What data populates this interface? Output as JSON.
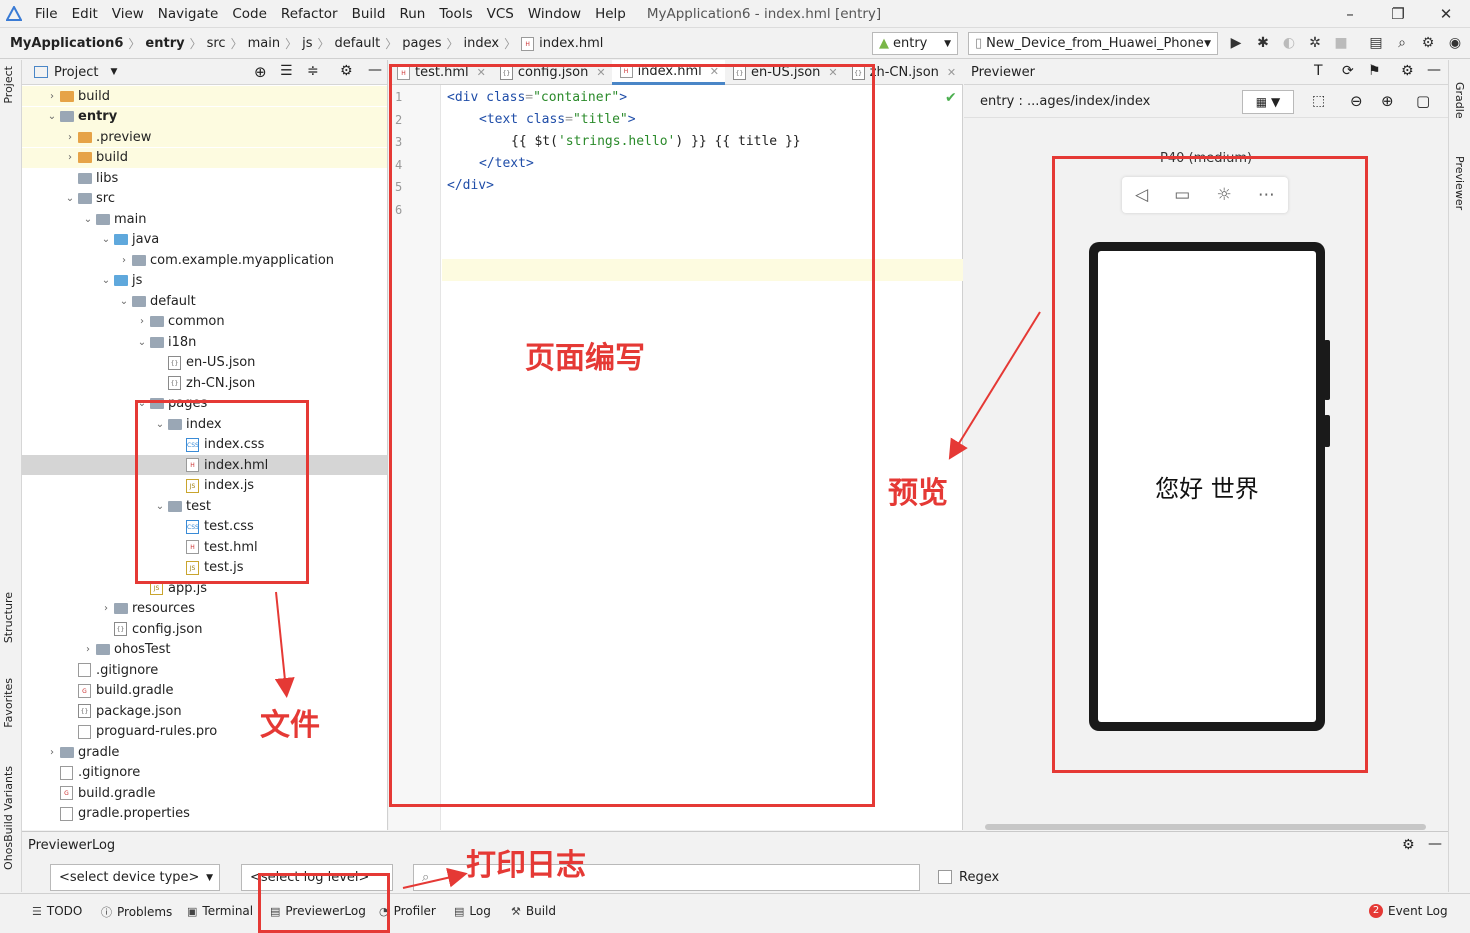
{
  "window": {
    "title": "MyApplication6 - index.hml [entry]",
    "menu": [
      "File",
      "Edit",
      "View",
      "Navigate",
      "Code",
      "Refactor",
      "Build",
      "Run",
      "Tools",
      "VCS",
      "Window",
      "Help"
    ],
    "controls": {
      "minimize": "–",
      "maximize": "❐",
      "close": "✕"
    }
  },
  "breadcrumb": [
    "MyApplication6",
    "entry",
    "src",
    "main",
    "js",
    "default",
    "pages",
    "index",
    "index.hml"
  ],
  "toolbar": {
    "config_combo": "entry",
    "device_combo": "New_Device_from_Huawei_Phone"
  },
  "left_tabs": [
    "Project",
    "Structure",
    "Favorites",
    "OhosBuild Variants"
  ],
  "right_tabs": [
    "Gradle",
    "Previewer"
  ],
  "project_panel": {
    "title": "Project",
    "tree": [
      {
        "label": "build",
        "depth": 0,
        "icon": "folder-orange",
        "arrow": "›"
      },
      {
        "label": "entry",
        "depth": 0,
        "icon": "folder-module",
        "arrow": "⌄",
        "bold": true
      },
      {
        "label": ".preview",
        "depth": 1,
        "icon": "folder-orange",
        "arrow": "›"
      },
      {
        "label": "build",
        "depth": 1,
        "icon": "folder-orange",
        "arrow": "›"
      },
      {
        "label": "libs",
        "depth": 1,
        "icon": "folder-gray",
        "arrow": ""
      },
      {
        "label": "src",
        "depth": 1,
        "icon": "folder-gray",
        "arrow": "⌄"
      },
      {
        "label": "main",
        "depth": 2,
        "icon": "folder-gray",
        "arrow": "⌄"
      },
      {
        "label": "java",
        "depth": 3,
        "icon": "folder-blue",
        "arrow": "⌄"
      },
      {
        "label": "com.example.myapplication",
        "depth": 4,
        "icon": "folder-gray",
        "arrow": "›"
      },
      {
        "label": "js",
        "depth": 3,
        "icon": "folder-blue",
        "arrow": "⌄"
      },
      {
        "label": "default",
        "depth": 4,
        "icon": "folder-gray",
        "arrow": "⌄"
      },
      {
        "label": "common",
        "depth": 5,
        "icon": "folder-gray",
        "arrow": "›"
      },
      {
        "label": "i18n",
        "depth": 5,
        "icon": "folder-gray",
        "arrow": "⌄"
      },
      {
        "label": "en-US.json",
        "depth": 6,
        "icon": "json",
        "arrow": ""
      },
      {
        "label": "zh-CN.json",
        "depth": 6,
        "icon": "json",
        "arrow": ""
      },
      {
        "label": "pages",
        "depth": 5,
        "icon": "folder-gray",
        "arrow": "⌄"
      },
      {
        "label": "index",
        "depth": 6,
        "icon": "folder-gray",
        "arrow": "⌄"
      },
      {
        "label": "index.css",
        "depth": 7,
        "icon": "css",
        "arrow": ""
      },
      {
        "label": "index.hml",
        "depth": 7,
        "icon": "hml",
        "arrow": "",
        "selected": true
      },
      {
        "label": "index.js",
        "depth": 7,
        "icon": "js",
        "arrow": ""
      },
      {
        "label": "test",
        "depth": 6,
        "icon": "folder-gray",
        "arrow": "⌄"
      },
      {
        "label": "test.css",
        "depth": 7,
        "icon": "css",
        "arrow": ""
      },
      {
        "label": "test.hml",
        "depth": 7,
        "icon": "hml",
        "arrow": ""
      },
      {
        "label": "test.js",
        "depth": 7,
        "icon": "js",
        "arrow": ""
      },
      {
        "label": "app.js",
        "depth": 5,
        "icon": "js",
        "arrow": ""
      },
      {
        "label": "resources",
        "depth": 3,
        "icon": "folder-gray",
        "arrow": "›"
      },
      {
        "label": "config.json",
        "depth": 3,
        "icon": "json",
        "arrow": ""
      },
      {
        "label": "ohosTest",
        "depth": 2,
        "icon": "folder-gray",
        "arrow": "›"
      },
      {
        "label": ".gitignore",
        "depth": 1,
        "icon": "file",
        "arrow": ""
      },
      {
        "label": "build.gradle",
        "depth": 1,
        "icon": "gradle",
        "arrow": ""
      },
      {
        "label": "package.json",
        "depth": 1,
        "icon": "json",
        "arrow": ""
      },
      {
        "label": "proguard-rules.pro",
        "depth": 1,
        "icon": "file",
        "arrow": ""
      },
      {
        "label": "gradle",
        "depth": 0,
        "icon": "folder-gray",
        "arrow": "›"
      },
      {
        "label": ".gitignore",
        "depth": 0,
        "icon": "file",
        "arrow": ""
      },
      {
        "label": "build.gradle",
        "depth": 0,
        "icon": "gradle",
        "arrow": ""
      },
      {
        "label": "gradle.properties",
        "depth": 0,
        "icon": "file",
        "arrow": ""
      }
    ]
  },
  "editor": {
    "tabs": [
      {
        "label": "test.hml",
        "icon": "hml"
      },
      {
        "label": "config.json",
        "icon": "json"
      },
      {
        "label": "index.hml",
        "icon": "hml",
        "active": true
      },
      {
        "label": "en-US.json",
        "icon": "json"
      },
      {
        "label": "zh-CN.json",
        "icon": "json"
      }
    ],
    "line_numbers": [
      "1",
      "2",
      "3",
      "4",
      "5",
      "6"
    ],
    "code": {
      "l1_tag": "<div ",
      "l1_attr": "class",
      "l1_eq": "=",
      "l1_val": "\"container\"",
      "l1_end": ">",
      "l2_tag": "<text ",
      "l2_attr": "class",
      "l2_eq": "=",
      "l2_val": "\"title\"",
      "l2_end": ">",
      "l3_a": "{{ $t(",
      "l3_str": "'strings.hello'",
      "l3_b": ") }} {{ title }}",
      "l4": "</text>",
      "l5": "</div>"
    }
  },
  "previewer": {
    "title": "Previewer",
    "path": "entry : ...ages/index/index",
    "device_label": "P40 (medium)",
    "screen_text": "您好 世界"
  },
  "log_panel": {
    "title": "PreviewerLog",
    "device_select": "<select device type>",
    "level_select": "<select log level>",
    "search_placeholder": "",
    "regex_label": "Regex"
  },
  "statusbar": {
    "items": [
      "TODO",
      "Problems",
      "Terminal",
      "PreviewerLog",
      "Profiler",
      "Log",
      "Build"
    ],
    "event_log": "Event Log",
    "event_count": "2"
  },
  "annotations": {
    "edit_label": "页面编写",
    "preview_label": "预览",
    "files_label": "文件",
    "log_label": "打印日志",
    "color": "#e53935"
  }
}
